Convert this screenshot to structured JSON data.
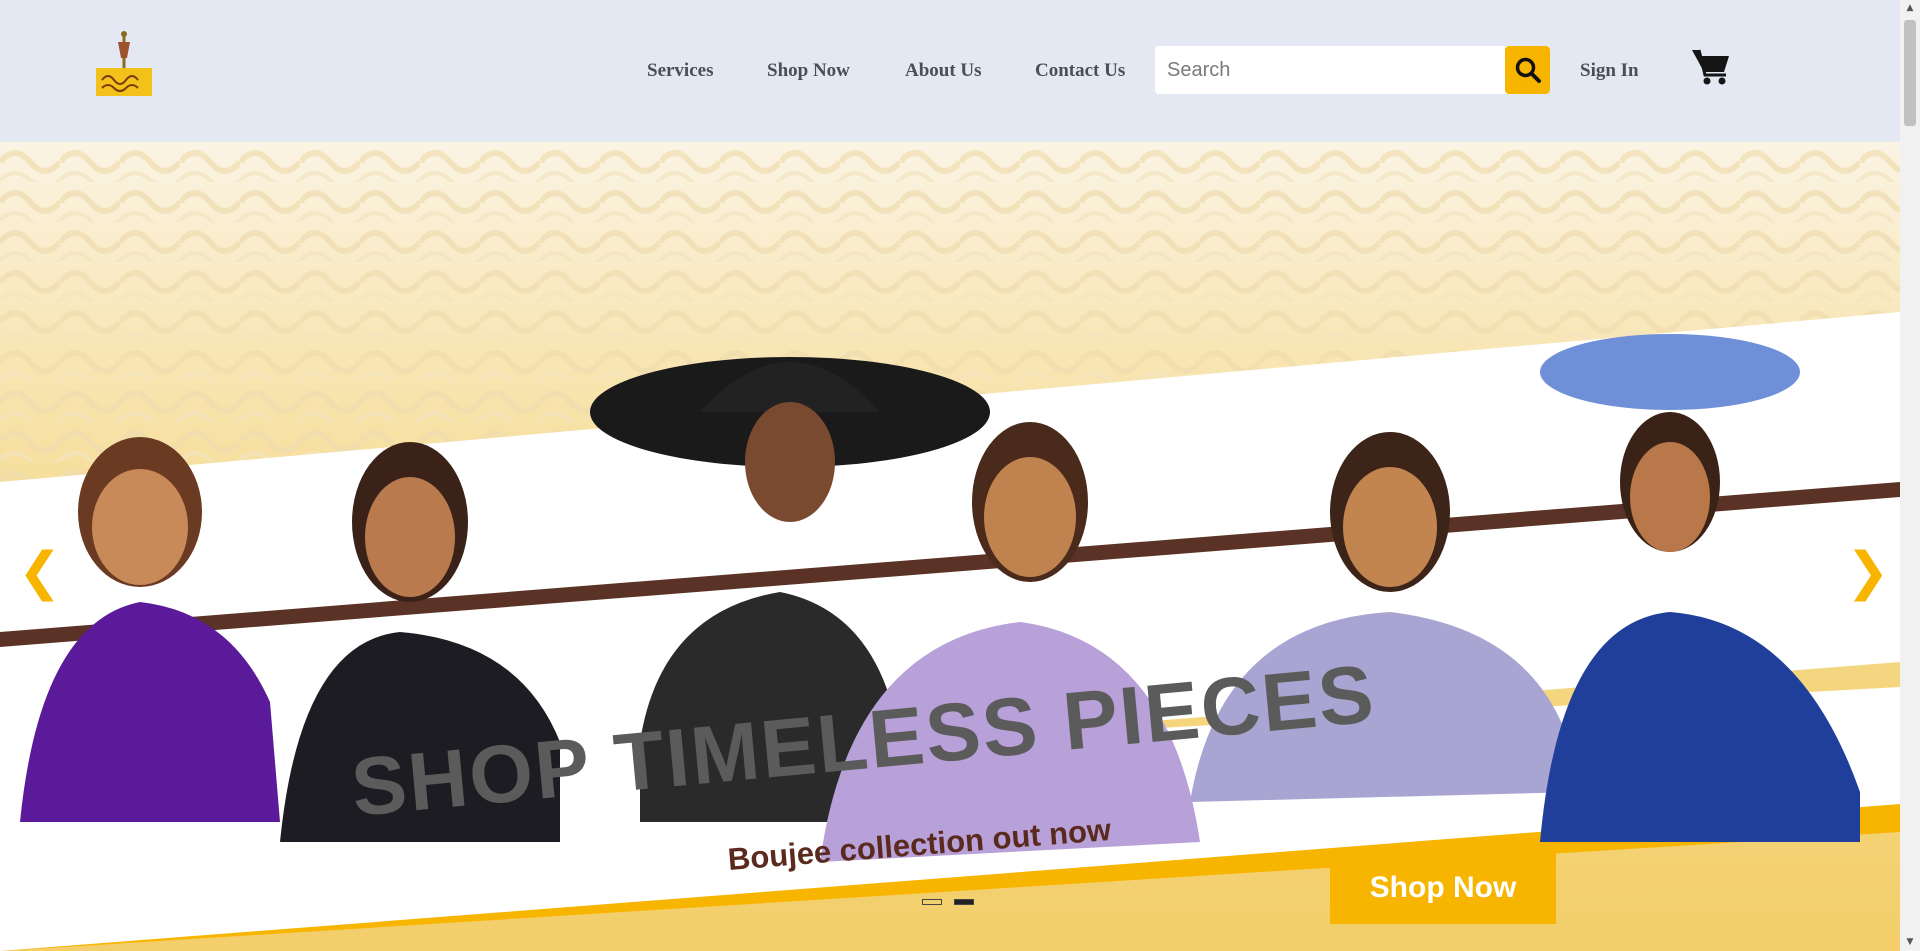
{
  "header": {
    "logo_icon": "mannequin-logo",
    "nav": [
      {
        "label": "Services"
      },
      {
        "label": "Shop Now"
      },
      {
        "label": "About Us"
      },
      {
        "label": "Contact Us"
      }
    ],
    "search": {
      "placeholder": "Search",
      "value": "",
      "icon": "search-icon"
    },
    "signin_label": "Sign In",
    "cart_icon": "shopping-cart-icon"
  },
  "hero": {
    "title": "SHOP TIMELESS PIECES",
    "subtitle": "Boujee collection out now",
    "cta_label": "Shop Now",
    "prev_arrow": "❮",
    "next_arrow": "❯",
    "slide_count": 2,
    "active_slide": 2
  },
  "colors": {
    "accent": "#f7b500",
    "header_bg": "#e4e8f3",
    "nav_text": "#4a4f55",
    "title_text": "#5b5b5b",
    "subtitle_text": "#5a2a1e"
  }
}
